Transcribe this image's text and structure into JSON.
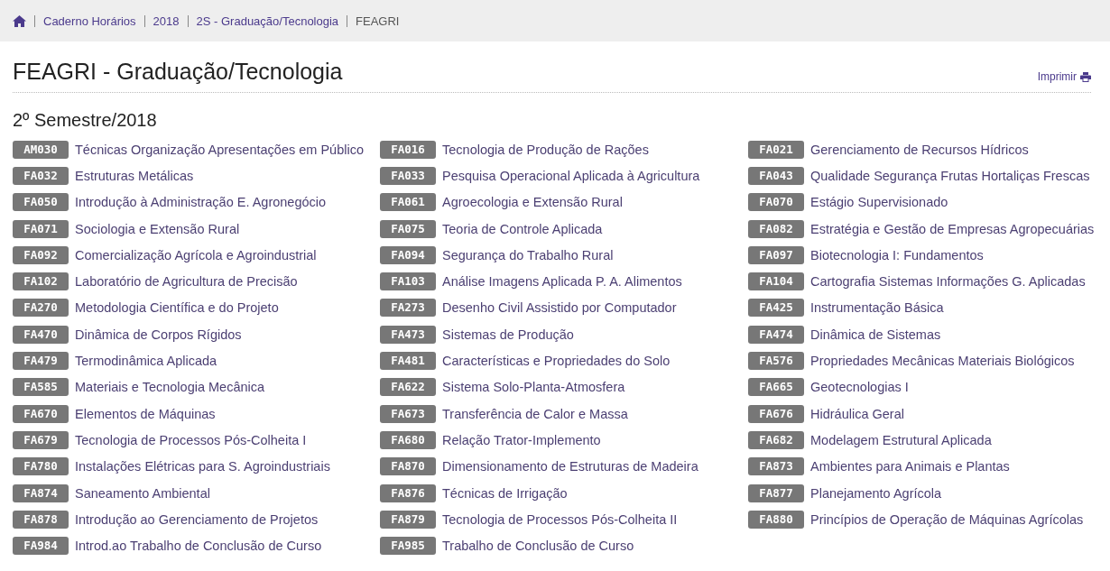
{
  "breadcrumb": [
    {
      "label": "Caderno Horários",
      "current": false
    },
    {
      "label": "2018",
      "current": false
    },
    {
      "label": "2S - Graduação/Tecnologia",
      "current": false
    },
    {
      "label": "FEAGRI",
      "current": true
    }
  ],
  "page_title": "FEAGRI - Graduação/Tecnologia",
  "print_link": "Imprimir",
  "section_title": "2º Semestre/2018",
  "courses": [
    {
      "code": "AM030",
      "name": "Técnicas Organização Apresentações em Público"
    },
    {
      "code": "FA016",
      "name": "Tecnologia de Produção de Rações"
    },
    {
      "code": "FA021",
      "name": "Gerenciamento de Recursos Hídricos"
    },
    {
      "code": "FA032",
      "name": "Estruturas Metálicas"
    },
    {
      "code": "FA033",
      "name": "Pesquisa Operacional Aplicada à Agricultura"
    },
    {
      "code": "FA043",
      "name": "Qualidade Segurança Frutas Hortaliças Frescas"
    },
    {
      "code": "FA050",
      "name": "Introdução à Administração E. Agronegócio"
    },
    {
      "code": "FA061",
      "name": "Agroecologia e Extensão Rural"
    },
    {
      "code": "FA070",
      "name": "Estágio Supervisionado"
    },
    {
      "code": "FA071",
      "name": "Sociologia e Extensão Rural"
    },
    {
      "code": "FA075",
      "name": "Teoria de Controle Aplicada"
    },
    {
      "code": "FA082",
      "name": "Estratégia e Gestão de Empresas Agropecuárias"
    },
    {
      "code": "FA092",
      "name": "Comercialização Agrícola e Agroindustrial"
    },
    {
      "code": "FA094",
      "name": "Segurança do Trabalho Rural"
    },
    {
      "code": "FA097",
      "name": "Biotecnologia I: Fundamentos"
    },
    {
      "code": "FA102",
      "name": "Laboratório de Agricultura de Precisão"
    },
    {
      "code": "FA103",
      "name": "Análise Imagens Aplicada P. A. Alimentos"
    },
    {
      "code": "FA104",
      "name": "Cartografia Sistemas Informações G. Aplicadas"
    },
    {
      "code": "FA270",
      "name": "Metodologia Científica e do Projeto"
    },
    {
      "code": "FA273",
      "name": "Desenho Civil Assistido por Computador"
    },
    {
      "code": "FA425",
      "name": "Instrumentação Básica"
    },
    {
      "code": "FA470",
      "name": "Dinâmica de Corpos Rígidos"
    },
    {
      "code": "FA473",
      "name": "Sistemas de Produção"
    },
    {
      "code": "FA474",
      "name": "Dinâmica de Sistemas"
    },
    {
      "code": "FA479",
      "name": "Termodinâmica Aplicada"
    },
    {
      "code": "FA481",
      "name": "Características e Propriedades do Solo"
    },
    {
      "code": "FA576",
      "name": "Propriedades Mecânicas Materiais Biológicos"
    },
    {
      "code": "FA585",
      "name": "Materiais e Tecnologia Mecânica"
    },
    {
      "code": "FA622",
      "name": "Sistema Solo-Planta-Atmosfera"
    },
    {
      "code": "FA665",
      "name": "Geotecnologias I"
    },
    {
      "code": "FA670",
      "name": "Elementos de Máquinas"
    },
    {
      "code": "FA673",
      "name": "Transferência de Calor e Massa"
    },
    {
      "code": "FA676",
      "name": "Hidráulica Geral"
    },
    {
      "code": "FA679",
      "name": "Tecnologia de Processos Pós-Colheita I"
    },
    {
      "code": "FA680",
      "name": "Relação Trator-Implemento"
    },
    {
      "code": "FA682",
      "name": "Modelagem Estrutural Aplicada"
    },
    {
      "code": "FA780",
      "name": "Instalações Elétricas para S. Agroindustriais"
    },
    {
      "code": "FA870",
      "name": "Dimensionamento de Estruturas de Madeira"
    },
    {
      "code": "FA873",
      "name": "Ambientes para Animais e Plantas"
    },
    {
      "code": "FA874",
      "name": "Saneamento Ambiental"
    },
    {
      "code": "FA876",
      "name": "Técnicas de Irrigação"
    },
    {
      "code": "FA877",
      "name": "Planejamento Agrícola"
    },
    {
      "code": "FA878",
      "name": "Introdução ao Gerenciamento de Projetos"
    },
    {
      "code": "FA879",
      "name": "Tecnologia de Processos Pós-Colheita II"
    },
    {
      "code": "FA880",
      "name": "Princípios de Operação de Máquinas Agrícolas"
    },
    {
      "code": "FA984",
      "name": "Introd.ao Trabalho de Conclusão de Curso"
    },
    {
      "code": "FA985",
      "name": "Trabalho de Conclusão de Curso"
    }
  ]
}
